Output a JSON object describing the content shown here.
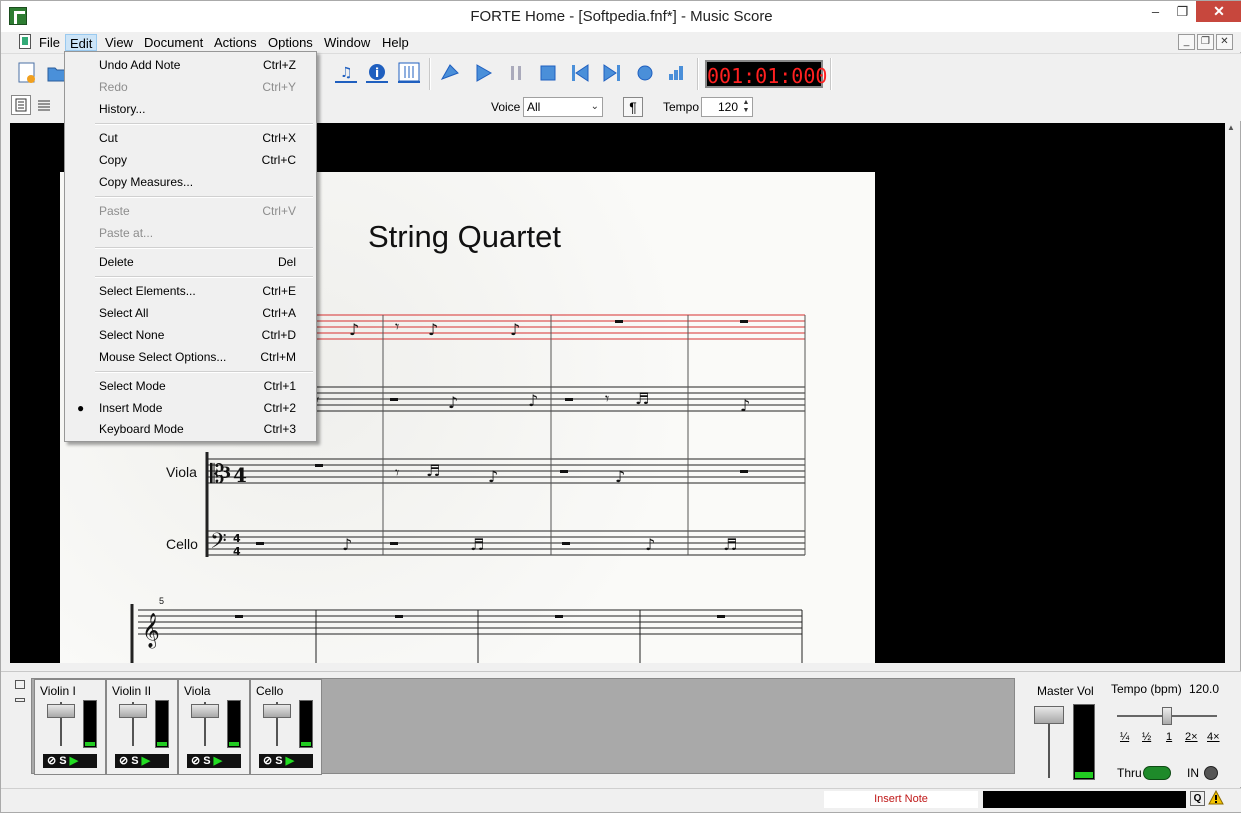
{
  "window": {
    "title": "FORTE Home - [Softpedia.fnf*] - Music Score"
  },
  "menubar": {
    "items": [
      "File",
      "Edit",
      "View",
      "Document",
      "Actions",
      "Options",
      "Window",
      "Help"
    ]
  },
  "edit_menu": {
    "groups": [
      [
        {
          "label": "Undo Add Note",
          "shortcut": "Ctrl+Z"
        },
        {
          "label": "Redo",
          "shortcut": "Ctrl+Y"
        },
        {
          "label": "History...",
          "shortcut": ""
        }
      ],
      [
        {
          "label": "Cut",
          "shortcut": "Ctrl+X"
        },
        {
          "label": "Copy",
          "shortcut": "Ctrl+C"
        },
        {
          "label": "Copy Measures...",
          "shortcut": ""
        }
      ],
      [
        {
          "label": "Paste",
          "shortcut": "Ctrl+V"
        },
        {
          "label": "Paste at...",
          "shortcut": ""
        }
      ],
      [
        {
          "label": "Delete",
          "shortcut": "Del"
        }
      ],
      [
        {
          "label": "Select Elements...",
          "shortcut": "Ctrl+E"
        },
        {
          "label": "Select All",
          "shortcut": "Ctrl+A"
        },
        {
          "label": "Select None",
          "shortcut": "Ctrl+D"
        },
        {
          "label": "Mouse Select Options...",
          "shortcut": "Ctrl+M"
        }
      ],
      [
        {
          "label": "Select Mode",
          "shortcut": "Ctrl+1"
        },
        {
          "label": "Insert Mode",
          "shortcut": "Ctrl+2"
        },
        {
          "label": "Keyboard Mode",
          "shortcut": "Ctrl+3"
        }
      ]
    ],
    "disabled": [
      "Redo",
      "Paste",
      "Paste at..."
    ],
    "checked": "Insert Mode"
  },
  "toolbar": {
    "timer": "001:01:000",
    "voice_label": "Voice",
    "voice_value": "All",
    "tempo_label": "Tempo",
    "tempo_value": "120"
  },
  "score": {
    "title": "String Quartet",
    "instruments": [
      "Viola",
      "Cello"
    ],
    "measure_number": "5",
    "time_signature": "4/4"
  },
  "mixer": {
    "channels": [
      "Violin I",
      "Violin II",
      "Viola",
      "Cello"
    ],
    "master_label": "Master Vol",
    "tempo_label": "Tempo (bpm)",
    "tempo_value": "120.0",
    "speeds": [
      "¼",
      "½",
      "1",
      "2×",
      "4×"
    ],
    "thru_label": "Thru",
    "in_label": "IN"
  },
  "status": {
    "mode": "Insert Note",
    "q_label": "Q"
  },
  "colors": {
    "timer": "#ff2020",
    "accent": "#cce4f7",
    "red_staff": "#d83030",
    "status_mode": "#c01818",
    "led_green": "#1e8a2a"
  }
}
